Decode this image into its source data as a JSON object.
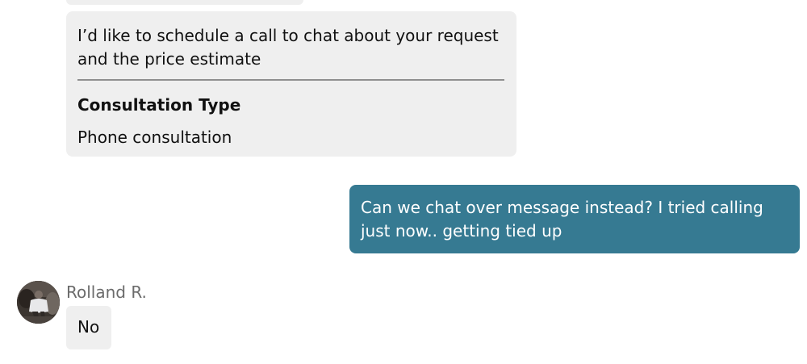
{
  "conversation": {
    "consultation_card": {
      "message": "I’d like to schedule a call to chat about your request and the price estimate",
      "type_label": "Consultation Type",
      "type_value": "Phone consultation"
    },
    "outgoing_message": {
      "text": "Can we chat over message instead? I tried calling just now.. getting tied up"
    },
    "incoming_message": {
      "sender_name": "Rolland R.",
      "avatar_icon": "user-photo-avatar",
      "text": "No"
    }
  },
  "colors": {
    "incoming_bubble": "#efefef",
    "outgoing_bubble": "#367a92",
    "divider": "#8f8f8f",
    "sender_name": "#6b6b6b"
  }
}
